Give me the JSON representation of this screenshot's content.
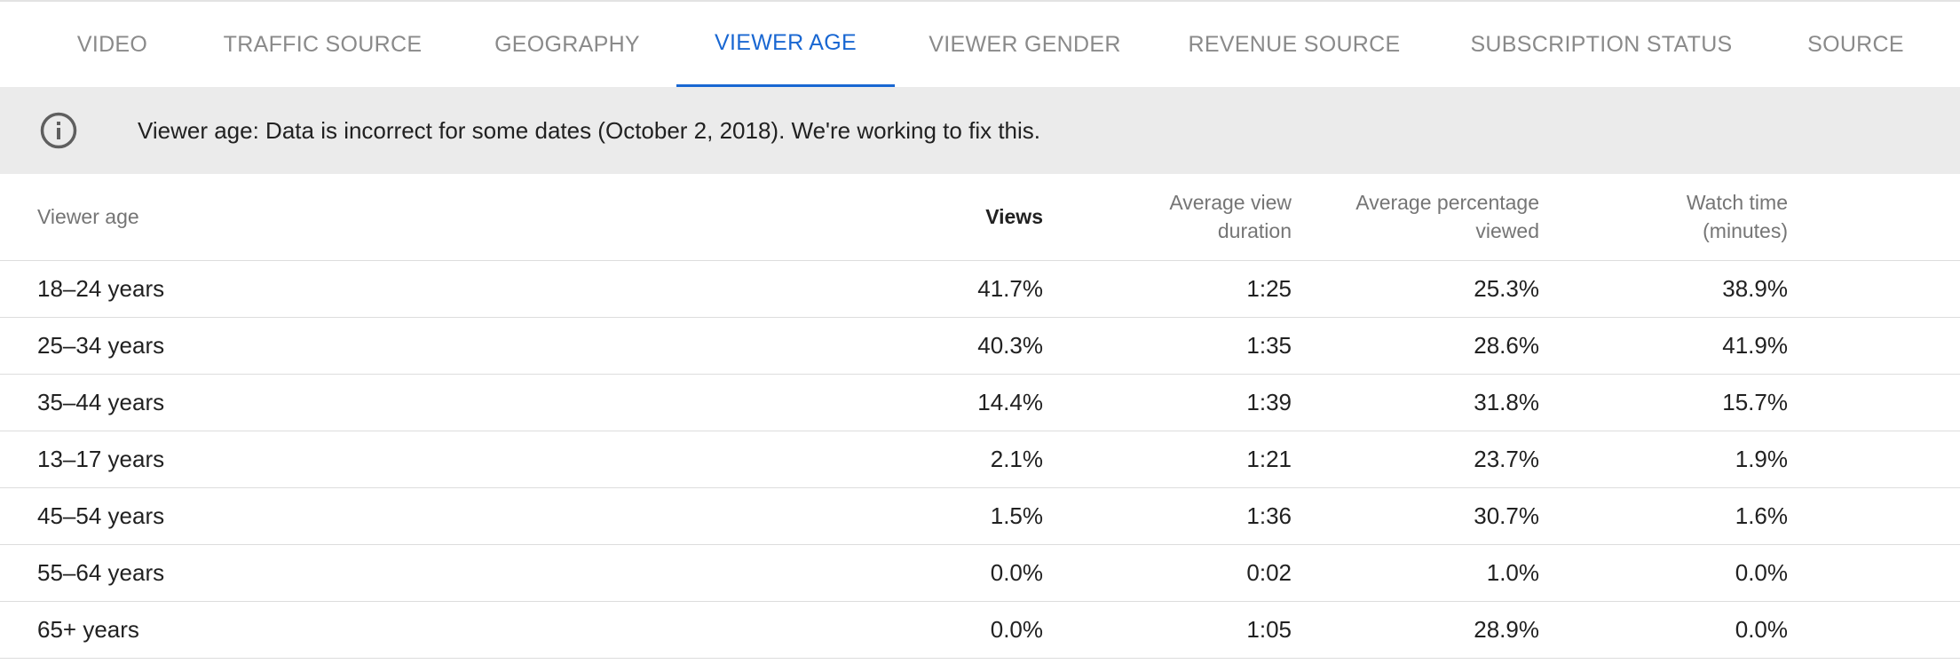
{
  "tabs": [
    {
      "label": "VIDEO",
      "active": false
    },
    {
      "label": "TRAFFIC SOURCE",
      "active": false
    },
    {
      "label": "GEOGRAPHY",
      "active": false
    },
    {
      "label": "VIEWER AGE",
      "active": true
    },
    {
      "label": "VIEWER GENDER",
      "active": false
    },
    {
      "label": "REVENUE SOURCE",
      "active": false
    },
    {
      "label": "SUBSCRIPTION STATUS",
      "active": false
    },
    {
      "label": "SOURCE",
      "active": false
    }
  ],
  "banner": {
    "icon": "info-icon",
    "text": "Viewer age: Data is incorrect for some dates (October 2, 2018). We're working to fix this."
  },
  "table": {
    "headers": {
      "viewer_age": "Viewer age",
      "views": "Views",
      "avg_view_duration": "Average view duration",
      "avg_percentage_viewed": "Average percentage viewed",
      "watch_time": "Watch time (minutes)"
    },
    "rows": [
      {
        "age": "18–24 years",
        "views": "41.7%",
        "avd": "1:25",
        "avp": "25.3%",
        "wt": "38.9%"
      },
      {
        "age": "25–34 years",
        "views": "40.3%",
        "avd": "1:35",
        "avp": "28.6%",
        "wt": "41.9%"
      },
      {
        "age": "35–44 years",
        "views": "14.4%",
        "avd": "1:39",
        "avp": "31.8%",
        "wt": "15.7%"
      },
      {
        "age": "13–17 years",
        "views": "2.1%",
        "avd": "1:21",
        "avp": "23.7%",
        "wt": "1.9%"
      },
      {
        "age": "45–54 years",
        "views": "1.5%",
        "avd": "1:36",
        "avp": "30.7%",
        "wt": "1.6%"
      },
      {
        "age": "55–64 years",
        "views": "0.0%",
        "avd": "0:02",
        "avp": "1.0%",
        "wt": "0.0%"
      },
      {
        "age": "65+ years",
        "views": "0.0%",
        "avd": "1:05",
        "avp": "28.9%",
        "wt": "0.0%"
      }
    ]
  },
  "colors": {
    "accent": "#1967d2",
    "tab_inactive": "#8a8a8a",
    "banner_bg": "#ebebeb",
    "text": "#212121",
    "header_text": "#757575",
    "divider": "#dddddd"
  }
}
